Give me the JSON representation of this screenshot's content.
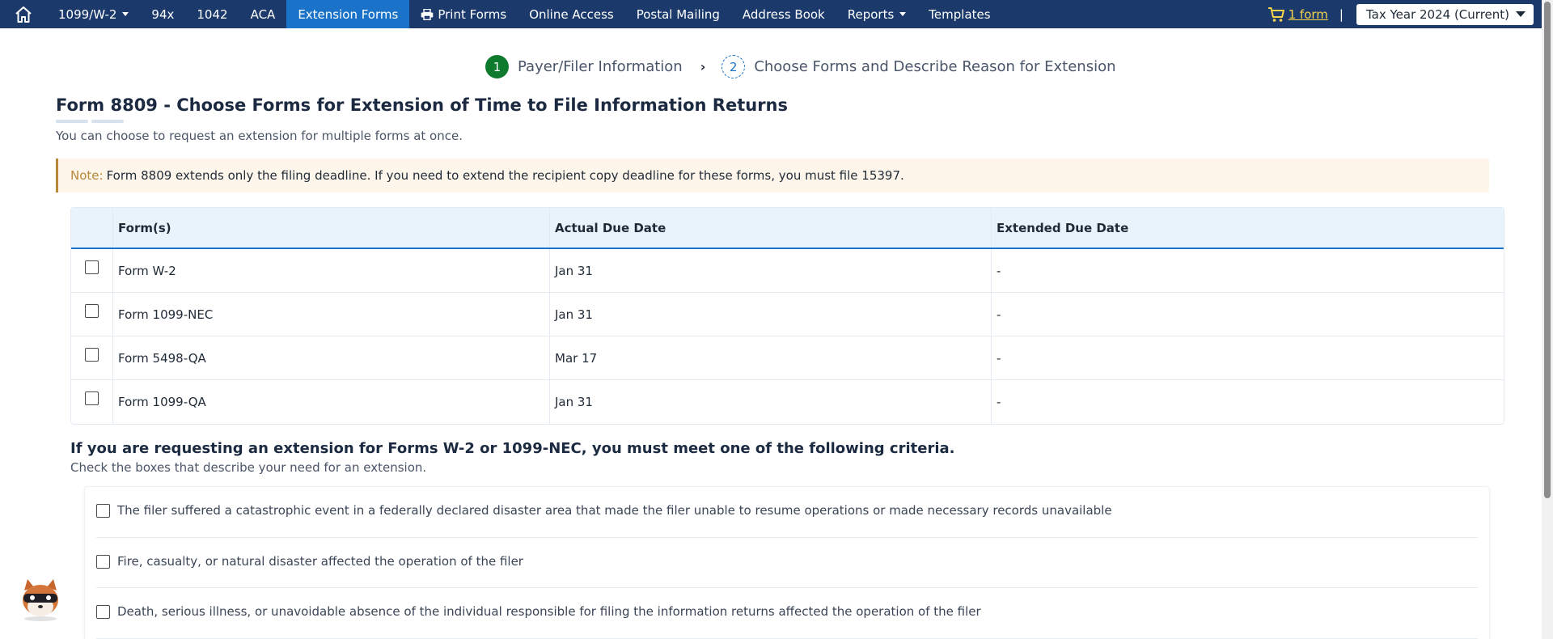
{
  "nav": {
    "items": [
      {
        "label": "1099/W-2",
        "has_caret": true
      },
      {
        "label": "94x"
      },
      {
        "label": "1042"
      },
      {
        "label": "ACA"
      },
      {
        "label": "Extension Forms",
        "active": true
      },
      {
        "label": "Print Forms",
        "icon": "printer-icon"
      },
      {
        "label": "Online Access"
      },
      {
        "label": "Postal Mailing"
      },
      {
        "label": "Address Book"
      },
      {
        "label": "Reports",
        "has_caret": true
      },
      {
        "label": "Templates"
      }
    ],
    "cart_label": "1 form",
    "separator": "|",
    "tax_year": "Tax Year 2024 (Current)"
  },
  "stepper": {
    "step1": {
      "number": "1",
      "label": "Payer/Filer Information"
    },
    "step2": {
      "number": "2",
      "label": "Choose Forms and Describe Reason for Extension"
    }
  },
  "page": {
    "title": "Form 8809 - Choose Forms for Extension of Time to File Information Returns",
    "subtitle": "You can choose to request an extension for multiple forms at once.",
    "note_label": "Note:",
    "note_text": "Form 8809 extends only the filing deadline. If you need to extend the recipient copy deadline for these forms, you must file 15397."
  },
  "table": {
    "headers": {
      "forms": "Form(s)",
      "due": "Actual Due Date",
      "extended": "Extended Due Date"
    },
    "rows": [
      {
        "form": "Form W-2",
        "due": "Jan 31",
        "extended": "-"
      },
      {
        "form": "Form 1099-NEC",
        "due": "Jan 31",
        "extended": "-"
      },
      {
        "form": "Form 5498-QA",
        "due": "Mar 17",
        "extended": "-"
      },
      {
        "form": "Form 1099-QA",
        "due": "Jan 31",
        "extended": "-"
      }
    ]
  },
  "criteria": {
    "title": "If you are requesting an extension for Forms W-2 or 1099-NEC, you must meet one of the following criteria.",
    "subtitle": "Check the boxes that describe your need for an extension.",
    "items": [
      "The filer suffered a catastrophic event in a federally declared disaster area that made the filer unable to resume operations or made necessary records unavailable",
      "Fire, casualty, or natural disaster affected the operation of the filer",
      "Death, serious illness, or unavoidable absence of the individual responsible for filing the information returns affected the operation of the filer"
    ]
  },
  "colors": {
    "nav_bg": "#1b3a6b",
    "nav_active": "#1a73c8",
    "cart": "#f5d34a",
    "step_done": "#0e7a2e",
    "note_bg": "#fef6ea",
    "note_accent": "#b8873a",
    "table_head_bg": "#e8f3fc"
  }
}
